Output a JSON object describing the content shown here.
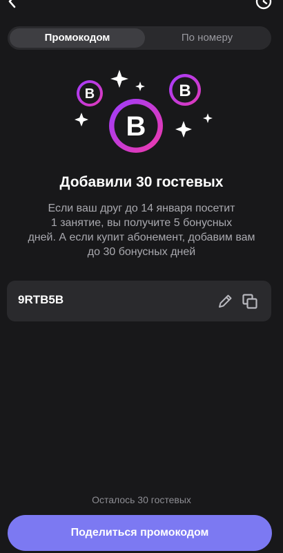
{
  "tabs": {
    "promo_label": "Промокодом",
    "phone_label": "По номеру",
    "active": "promo"
  },
  "icons": {
    "back": "chevron-left-icon",
    "history": "history-icon",
    "badge_letter": "В",
    "edit": "pencil-icon",
    "copy": "copy-icon"
  },
  "main": {
    "title": "Добавили 30 гостевых",
    "description_lines": [
      "Если ваш друг до 14 января посетит",
      "1 занятие, вы получите 5 бонусных",
      "дней. А если купит абонемент, добавим вам",
      "до 30 бонусных дней"
    ]
  },
  "promo": {
    "code": "9RTB5B"
  },
  "footer": {
    "remaining_text": "Осталось 30 гостевых",
    "share_label": "Поделиться промокодом"
  },
  "colors": {
    "background": "#18181a",
    "surface": "#2a2a2d",
    "accent": "#7c79f2",
    "badge_gradient_start": "#9b3cff",
    "badge_gradient_end": "#f13aa8"
  }
}
